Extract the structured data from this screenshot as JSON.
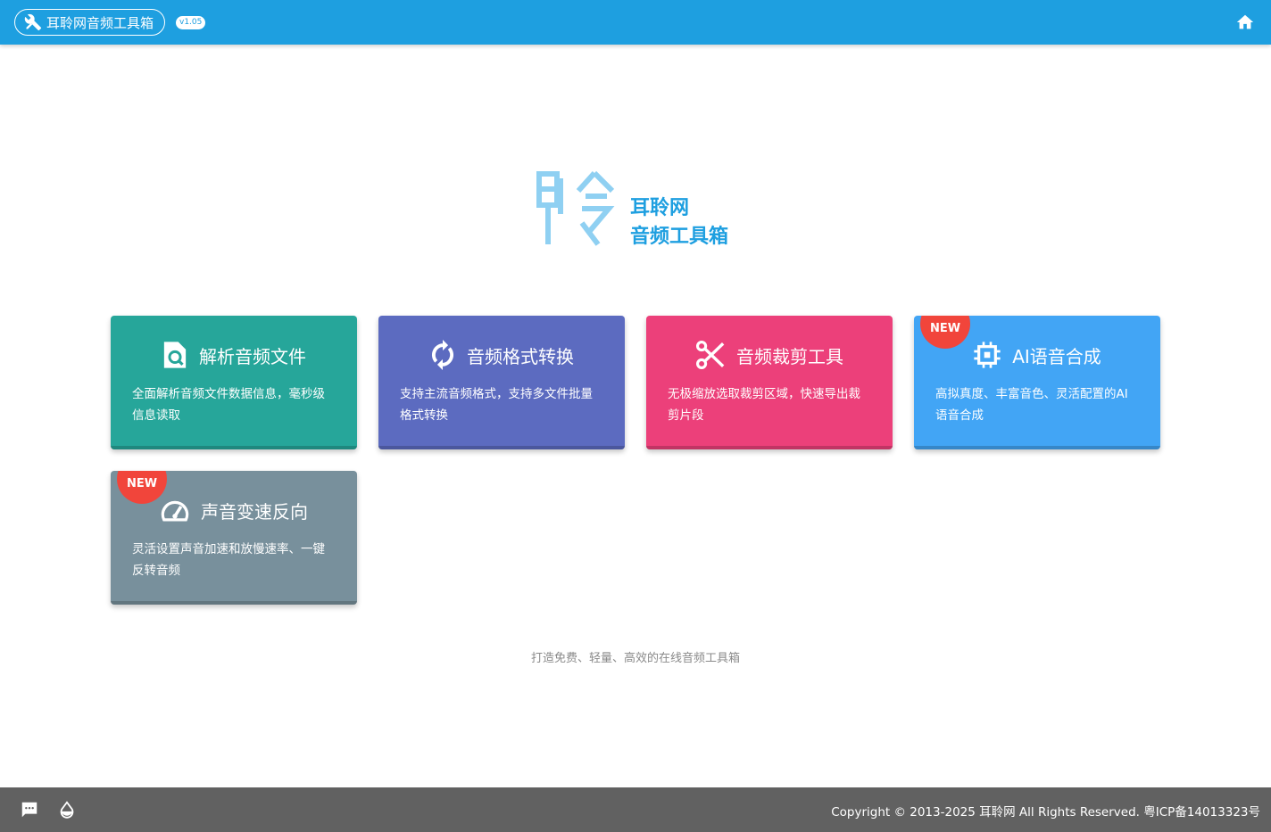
{
  "header": {
    "brand_label": "耳聆网音频工具箱",
    "version": "v1.05",
    "brand_icon": "tools-icon",
    "home_icon": "home-icon",
    "color": "#1e9fe0"
  },
  "logo": {
    "line1": "耳聆网",
    "line2": "音频工具箱"
  },
  "cards": [
    {
      "title": "解析音频文件",
      "desc": "全面解析音频文件数据信息，毫秒级信息读取",
      "icon": "file-search-icon",
      "color": "#26a69a",
      "badge": ""
    },
    {
      "title": "音频格式转换",
      "desc": "支持主流音频格式，支持多文件批量格式转换",
      "icon": "sync-icon",
      "color": "#5c6bc0",
      "badge": ""
    },
    {
      "title": "音频裁剪工具",
      "desc": "无极缩放选取裁剪区域，快速导出裁剪片段",
      "icon": "scissors-icon",
      "color": "#ec407a",
      "badge": ""
    },
    {
      "title": "AI语音合成",
      "desc": "高拟真度、丰富音色、灵活配置的AI语音合成",
      "icon": "chip-icon",
      "color": "#42a5f5",
      "badge": "NEW"
    },
    {
      "title": "声音变速反向",
      "desc": "灵活设置声音加速和放慢速率、一键反转音频",
      "icon": "speedometer-icon",
      "color": "#78909c",
      "badge": "NEW"
    }
  ],
  "tagline": "打造免费、轻量、高效的在线音频工具箱",
  "footer": {
    "copyright": "Copyright © 2013-2025 耳聆网 All Rights Reserved. 粤ICP备14013323号",
    "chat_icon": "chat-icon",
    "theme_icon": "drop-icon",
    "color": "#616161"
  }
}
